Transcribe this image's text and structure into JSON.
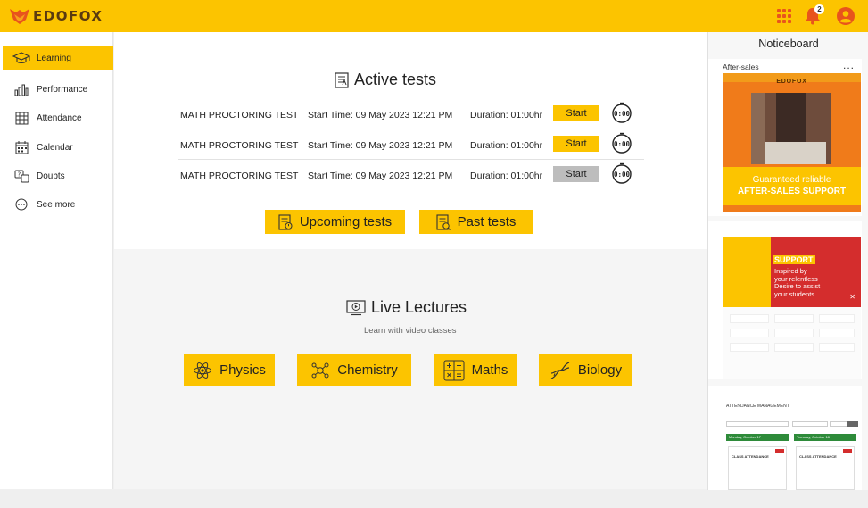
{
  "header": {
    "brand": "EDOFOX",
    "notification_count": "2"
  },
  "sidebar": {
    "items": [
      {
        "label": "Learning",
        "icon": "graduation-cap-icon",
        "active": true
      },
      {
        "label": "Performance",
        "icon": "bar-chart-icon",
        "active": false
      },
      {
        "label": "Attendance",
        "icon": "attendance-icon",
        "active": false
      },
      {
        "label": "Calendar",
        "icon": "calendar-icon",
        "active": false
      },
      {
        "label": "Doubts",
        "icon": "doubts-icon",
        "active": false
      },
      {
        "label": "See more",
        "icon": "more-icon",
        "active": false
      }
    ]
  },
  "active_tests": {
    "title": "Active tests",
    "rows": [
      {
        "name": "MATH PROCTORING TEST",
        "start": "Start Time: 09 May 2023 12:21 PM",
        "duration": "Duration: 01:00hr",
        "button": "Start",
        "enabled": true
      },
      {
        "name": "MATH PROCTORING TEST",
        "start": "Start Time: 09 May 2023 12:21 PM",
        "duration": "Duration: 01:00hr",
        "button": "Start",
        "enabled": true
      },
      {
        "name": "MATH PROCTORING TEST",
        "start": "Start Time: 09 May 2023 12:21 PM",
        "duration": "Duration: 01:00hr",
        "button": "Start",
        "enabled": false
      }
    ],
    "timer_text": "0:00",
    "upcoming_label": "Upcoming tests",
    "past_label": "Past tests"
  },
  "live_lectures": {
    "title": "Live Lectures",
    "subtitle": "Learn with video classes",
    "subjects": [
      {
        "label": "Physics",
        "icon": "atom-icon"
      },
      {
        "label": "Chemistry",
        "icon": "molecule-icon"
      },
      {
        "label": "Maths",
        "icon": "calculator-icon"
      },
      {
        "label": "Biology",
        "icon": "dna-icon"
      }
    ]
  },
  "noticeboard": {
    "title": "Noticeboard",
    "card1": {
      "label": "After-sales",
      "more": "...",
      "brand": "EDOFOX",
      "line1": "Guaranteed reliable",
      "line2": "AFTER-SALES SUPPORT"
    },
    "card2": {
      "heading": "SUPPORT",
      "line1": "Inspired by",
      "line2": "your relentless",
      "line3": "Desire to assist",
      "line4": "your students"
    },
    "card3": {
      "heading": "ATTENDANCE MANAGEMENT",
      "col1": "Monday, October 17",
      "col2": "Tuesday, October 18",
      "class_title": "CLASS ATTENDANCE"
    }
  },
  "colors": {
    "brand_yellow": "#fcc400",
    "accent_orange": "#e8541c",
    "support_red": "#d42d2d"
  }
}
